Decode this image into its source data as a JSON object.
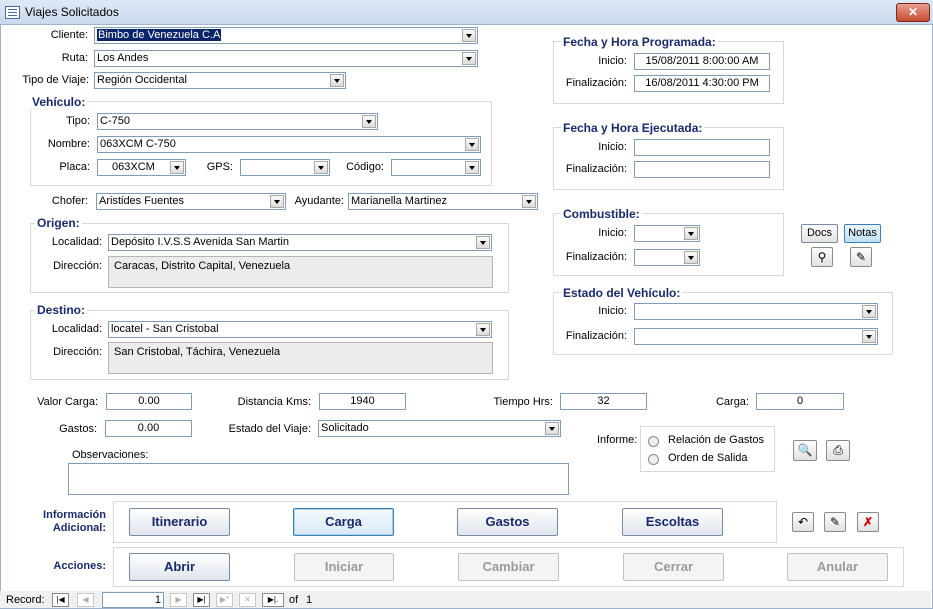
{
  "window": {
    "title": "Viajes Solicitados"
  },
  "form": {
    "cliente_label": "Cliente:",
    "cliente_value": "Bimbo de Venezuela C.A",
    "ruta_label": "Ruta:",
    "ruta_value": "Los Andes",
    "tipo_viaje_label": "Tipo de Viaje:",
    "tipo_viaje_value": "Región Occidental",
    "chofer_label": "Chofer:",
    "chofer_value": "Aristides Fuentes",
    "ayudante_label": "Ayudante:",
    "ayudante_value": "Marianella Martinez"
  },
  "vehiculo": {
    "title": "Vehículo:",
    "tipo_label": "Tipo:",
    "tipo_value": "C-750",
    "nombre_label": "Nombre:",
    "nombre_value": "063XCM C-750",
    "placa_label": "Placa:",
    "placa_value": "063XCM",
    "gps_label": "GPS:",
    "gps_value": "",
    "codigo_label": "Código:",
    "codigo_value": ""
  },
  "origen": {
    "title": "Origen:",
    "localidad_label": "Localidad:",
    "localidad_value": "Depósito I.V.S.S Avenida San Martin",
    "direccion_label": "Dirección:",
    "direccion_value": "Caracas, Distrito Capital, Venezuela"
  },
  "destino": {
    "title": "Destino:",
    "localidad_label": "Localidad:",
    "localidad_value": "locatel - San  Cristobal",
    "direccion_label": "Dirección:",
    "direccion_value": "San Cristobal, Táchira, Venezuela"
  },
  "programada": {
    "title": "Fecha y Hora Programada:",
    "inicio_label": "Inicio:",
    "inicio_value": "15/08/2011 8:00:00 AM",
    "fin_label": "Finalización:",
    "fin_value": "16/08/2011 4:30:00 PM"
  },
  "ejecutada": {
    "title": "Fecha y Hora Ejecutada:",
    "inicio_label": "Inicio:",
    "inicio_value": "",
    "fin_label": "Finalización:",
    "fin_value": ""
  },
  "combustible": {
    "title": "Combustible:",
    "inicio_label": "Inicio:",
    "inicio_value": "",
    "fin_label": "Finalización:",
    "fin_value": ""
  },
  "estado_vehiculo": {
    "title": "Estado del Vehículo:",
    "inicio_label": "Inicio:",
    "inicio_value": "",
    "fin_label": "Finalización:",
    "fin_value": ""
  },
  "side_buttons": {
    "docs": "Docs",
    "notas": "Notas"
  },
  "metrics": {
    "valor_carga_label": "Valor Carga:",
    "valor_carga_value": "0.00",
    "distancia_label": "Distancia Kms:",
    "distancia_value": "1940",
    "tiempo_label": "Tiempo Hrs:",
    "tiempo_value": "32",
    "carga_label": "Carga:",
    "carga_value": "0",
    "gastos_label": "Gastos:",
    "gastos_value": "0.00",
    "estado_label": "Estado del Viaje:",
    "estado_value": "Solicitado"
  },
  "informe": {
    "label": "Informe:",
    "opt1": "Relación de Gastos",
    "opt2": "Orden de Salida"
  },
  "observaciones": {
    "label": "Observaciones:",
    "value": ""
  },
  "info_adicional": {
    "label_line1": "Información",
    "label_line2": "Adicional:",
    "itinerario": "Itinerario",
    "carga": "Carga",
    "gastos": "Gastos",
    "escoltas": "Escoltas"
  },
  "acciones": {
    "label": "Acciones:",
    "abrir": "Abrir",
    "iniciar": "Iniciar",
    "cambiar": "Cambiar",
    "cerrar": "Cerrar",
    "anular": "Anular"
  },
  "record_nav": {
    "label": "Record:",
    "current": "1",
    "of_label": "of",
    "total": "1"
  },
  "icons": [
    "window-icon",
    "close-icon",
    "dropdown-arrow-icon",
    "binoculars-icon",
    "edit-note-icon",
    "print-preview-icon",
    "printer-icon",
    "undo-icon",
    "save-edit-icon",
    "delete-icon",
    "first-record-icon",
    "prev-record-icon",
    "next-record-icon",
    "last-record-icon",
    "new-record-icon",
    "filter-icon"
  ],
  "colors": {
    "title_blue": "#1a2a6c",
    "selection": "#0a246a",
    "close_red": "#c44a30"
  }
}
